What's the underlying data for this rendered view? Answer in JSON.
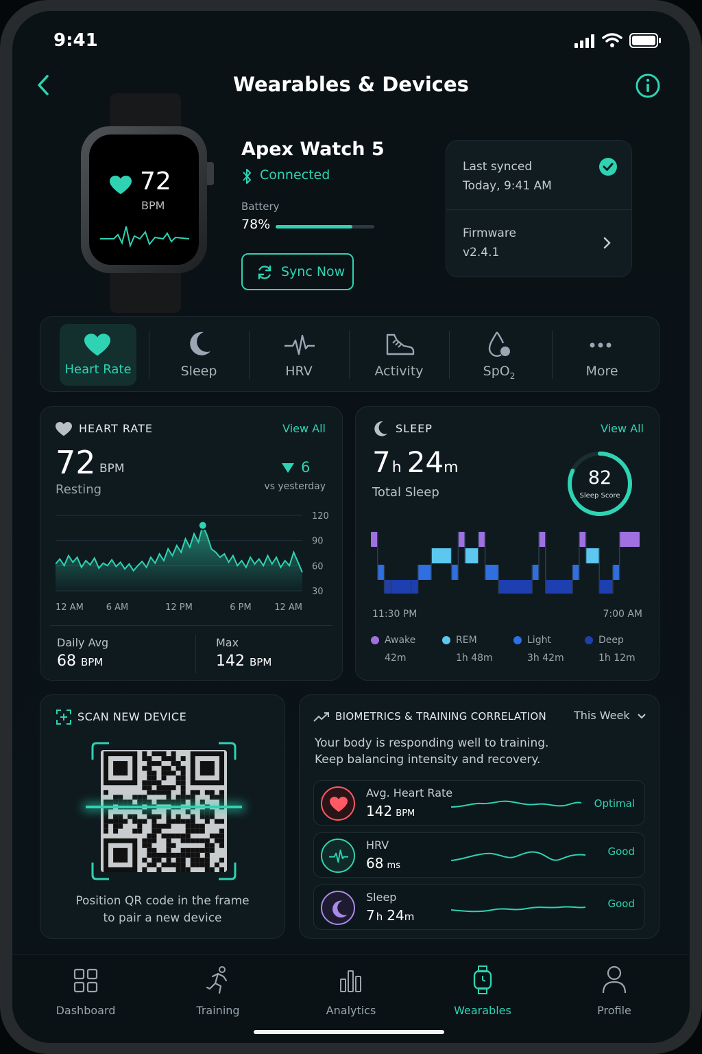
{
  "status_bar": {
    "time": "9:41"
  },
  "header": {
    "title": "Wearables & Devices"
  },
  "device": {
    "watch_bpm": "72",
    "watch_unit": "BPM",
    "name": "Apex Watch 5",
    "status": "Connected",
    "battery_label": "Battery",
    "battery_value": "78%",
    "battery_level": 0.78,
    "sync_label": "Sync Now"
  },
  "sync_info": {
    "last_synced_label": "Last synced",
    "last_synced_value": "Today, 9:41 AM",
    "firmware_label": "Firmware",
    "firmware_value": "v2.4.1"
  },
  "metric_tabs": [
    {
      "label": "Heart Rate",
      "icon": "heart-icon",
      "active": true
    },
    {
      "label": "Sleep",
      "icon": "moon-icon"
    },
    {
      "label": "HRV",
      "icon": "pulse-icon"
    },
    {
      "label": "Activity",
      "icon": "shoe-icon"
    },
    {
      "label": "SpO",
      "sub": "2",
      "icon": "drop-icon"
    },
    {
      "label": "More",
      "icon": "more-icon"
    }
  ],
  "heart_rate": {
    "title": "HEART RATE",
    "view_all": "View All",
    "value": "72",
    "unit": "BPM",
    "sub": "Resting",
    "delta": "6",
    "delta_label": "vs yesterday",
    "chart_data": {
      "type": "area",
      "x_ticks": [
        "12 AM",
        "6 AM",
        "12 PM",
        "6 PM",
        "12 AM"
      ],
      "y_ticks": [
        "120",
        "90",
        "60",
        "30"
      ],
      "ylim": [
        30,
        120
      ],
      "values": [
        62,
        68,
        60,
        72,
        64,
        70,
        58,
        66,
        61,
        69,
        57,
        63,
        60,
        67,
        59,
        64,
        56,
        62,
        54,
        60,
        65,
        58,
        70,
        63,
        74,
        66,
        80,
        72,
        84,
        76,
        92,
        82,
        98,
        88,
        108,
        96,
        80,
        76,
        70,
        74,
        64,
        72,
        60,
        66,
        58,
        70,
        62,
        68,
        60,
        72,
        62,
        70,
        58,
        66,
        60,
        76,
        64,
        52
      ]
    },
    "daily_avg_label": "Daily Avg",
    "daily_avg_value": "68",
    "max_label": "Max",
    "max_value": "142",
    "bpm_unit": "BPM"
  },
  "sleep": {
    "title": "SLEEP",
    "view_all": "View All",
    "hours": "7",
    "h": "h",
    "minutes": "24",
    "m": "m",
    "sub": "Total Sleep",
    "score": "82",
    "score_label": "Sleep Score",
    "score_fraction": 0.82,
    "start": "11:30 PM",
    "end": "7:00 AM",
    "chart_data": {
      "type": "bar",
      "stages": [
        "Awake",
        "REM",
        "Light",
        "Deep"
      ],
      "segments": [
        {
          "stage": "Awake",
          "start": 0,
          "dur": 1
        },
        {
          "stage": "Light",
          "start": 1,
          "dur": 1
        },
        {
          "stage": "Deep",
          "start": 2,
          "dur": 1
        },
        {
          "stage": "Deep",
          "start": 3,
          "dur": 3
        },
        {
          "stage": "Deep",
          "start": 6,
          "dur": 1
        },
        {
          "stage": "Light",
          "start": 7,
          "dur": 2
        },
        {
          "stage": "REM",
          "start": 9,
          "dur": 3
        },
        {
          "stage": "Light",
          "start": 12,
          "dur": 1
        },
        {
          "stage": "Awake",
          "start": 13,
          "dur": 1
        },
        {
          "stage": "REM",
          "start": 14,
          "dur": 2
        },
        {
          "stage": "Awake",
          "start": 16,
          "dur": 1
        },
        {
          "stage": "Light",
          "start": 17,
          "dur": 2
        },
        {
          "stage": "Deep",
          "start": 19,
          "dur": 5
        },
        {
          "stage": "Light",
          "start": 24,
          "dur": 1
        },
        {
          "stage": "Awake",
          "start": 25,
          "dur": 1
        },
        {
          "stage": "Deep",
          "start": 26,
          "dur": 4
        },
        {
          "stage": "Light",
          "start": 30,
          "dur": 1
        },
        {
          "stage": "Awake",
          "start": 31,
          "dur": 1
        },
        {
          "stage": "REM",
          "start": 32,
          "dur": 2
        },
        {
          "stage": "Deep",
          "start": 34,
          "dur": 2
        },
        {
          "stage": "Light",
          "start": 36,
          "dur": 1
        },
        {
          "stage": "Awake",
          "start": 37,
          "dur": 3
        }
      ],
      "total_units": 40
    },
    "legend": [
      {
        "name": "Awake",
        "value": "42m",
        "color": "#a070e0"
      },
      {
        "name": "REM",
        "value": "1h 48m",
        "color": "#5cc8f0"
      },
      {
        "name": "Light",
        "value": "3h 42m",
        "color": "#2f6fe0"
      },
      {
        "name": "Deep",
        "value": "1h 12m",
        "color": "#1d3fb0"
      }
    ]
  },
  "scan": {
    "title": "SCAN NEW DEVICE",
    "line1": "Position QR code in the frame",
    "line2": "to pair a new device"
  },
  "correlation": {
    "title": "BIOMETRICS & TRAINING CORRELATION",
    "period": "This Week",
    "msg1": "Your body is responding well to training.",
    "msg2": "Keep balancing intensity and recovery.",
    "rows": [
      {
        "label": "Avg. Heart Rate",
        "value": "142",
        "unit": "BPM",
        "status": "Optimal",
        "icon": "heart-icon"
      },
      {
        "label": "HRV",
        "value": "68",
        "unit": "ms",
        "status": "Good",
        "icon": "pulse-icon"
      },
      {
        "label": "Sleep",
        "value": "7",
        "unit": "h",
        "value2": "24",
        "unit2": "m",
        "status": "Good",
        "icon": "moon-icon"
      }
    ]
  },
  "nav": [
    {
      "label": "Dashboard",
      "icon": "grid-icon"
    },
    {
      "label": "Training",
      "icon": "runner-icon"
    },
    {
      "label": "Analytics",
      "icon": "bars-icon"
    },
    {
      "label": "Wearables",
      "icon": "watch-icon",
      "active": true
    },
    {
      "label": "Profile",
      "icon": "person-icon"
    }
  ],
  "colors": {
    "accent": "#2fd3b3",
    "card": "#0f1a1f",
    "bg": "#0a1216",
    "heart": "#ff5a64",
    "moon": "#a88ae8"
  }
}
